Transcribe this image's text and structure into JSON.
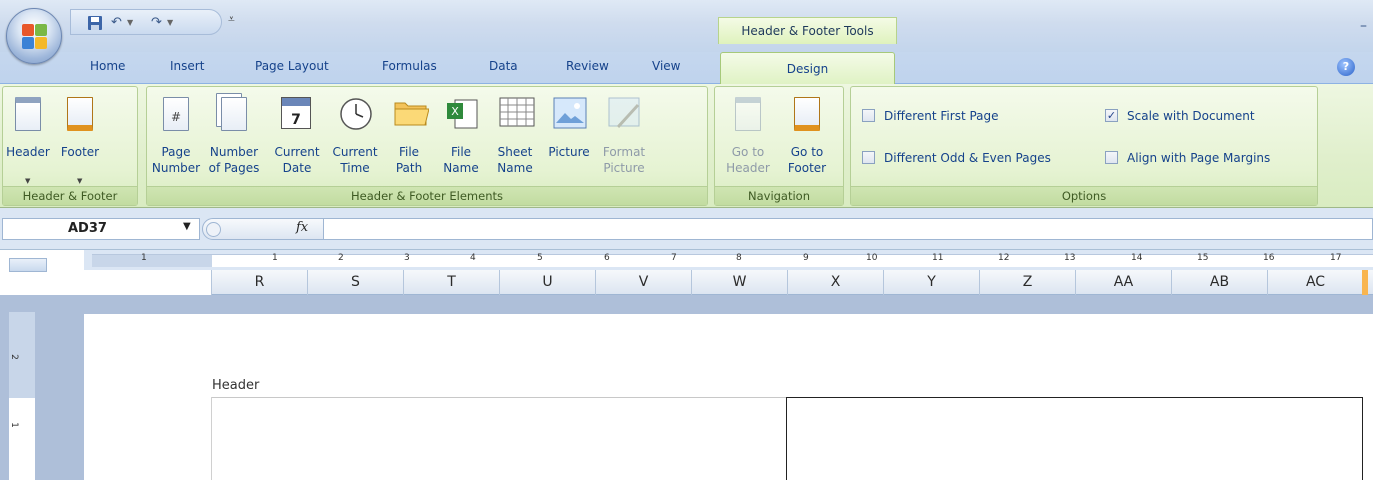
{
  "title_bar": {
    "context_tab_group": "Header & Footer Tools",
    "qat": {
      "save_icon": "save-icon",
      "undo_icon": "undo-icon",
      "redo_icon": "redo-icon",
      "customize_icon": "customize-qat-icon"
    }
  },
  "tabs": [
    "Home",
    "Insert",
    "Page Layout",
    "Formulas",
    "Data",
    "Review",
    "View"
  ],
  "active_tab": "Design",
  "ribbon": {
    "groups": {
      "header_footer": {
        "label": "Header & Footer",
        "buttons": {
          "header": "Header",
          "footer": "Footer"
        }
      },
      "elements": {
        "label": "Header & Footer Elements",
        "buttons": {
          "page_number": [
            "Page",
            "Number"
          ],
          "number_of_pages": [
            "Number",
            "of Pages"
          ],
          "current_date": [
            "Current",
            "Date"
          ],
          "current_time": [
            "Current",
            "Time"
          ],
          "file_path": [
            "File",
            "Path"
          ],
          "file_name": [
            "File",
            "Name"
          ],
          "sheet_name": [
            "Sheet",
            "Name"
          ],
          "picture": [
            "Picture",
            ""
          ],
          "format_picture": [
            "Format",
            "Picture"
          ]
        }
      },
      "navigation": {
        "label": "Navigation",
        "buttons": {
          "go_to_header": [
            "Go to",
            "Header"
          ],
          "go_to_footer": [
            "Go to",
            "Footer"
          ]
        }
      },
      "options": {
        "label": "Options",
        "checkboxes": {
          "different_first_page": {
            "label": "Different First Page",
            "checked": false
          },
          "scale_with_document": {
            "label": "Scale with Document",
            "checked": true
          },
          "different_odd_even": {
            "label": "Different Odd & Even Pages",
            "checked": false
          },
          "align_with_margins": {
            "label": "Align with Page Margins",
            "checked": false
          }
        }
      }
    }
  },
  "formula_bar": {
    "name_box": "AD37",
    "fx_label": "fx",
    "formula": ""
  },
  "ruler": {
    "numbers": [
      "1",
      "1",
      "2",
      "3",
      "4",
      "5",
      "6",
      "7",
      "8",
      "9",
      "10",
      "11",
      "12",
      "13",
      "14",
      "15",
      "16",
      "17"
    ]
  },
  "columns": [
    "R",
    "S",
    "T",
    "U",
    "V",
    "W",
    "X",
    "Y",
    "Z",
    "AA",
    "AB",
    "AC"
  ],
  "vertical_ruler": [
    "2",
    "1"
  ],
  "page": {
    "header_label": "Header"
  },
  "colors": {
    "ribbon_green": "#e0efcc",
    "tab_bar": "#c5d7ee",
    "selected_column_edge": "#f9b54f"
  }
}
